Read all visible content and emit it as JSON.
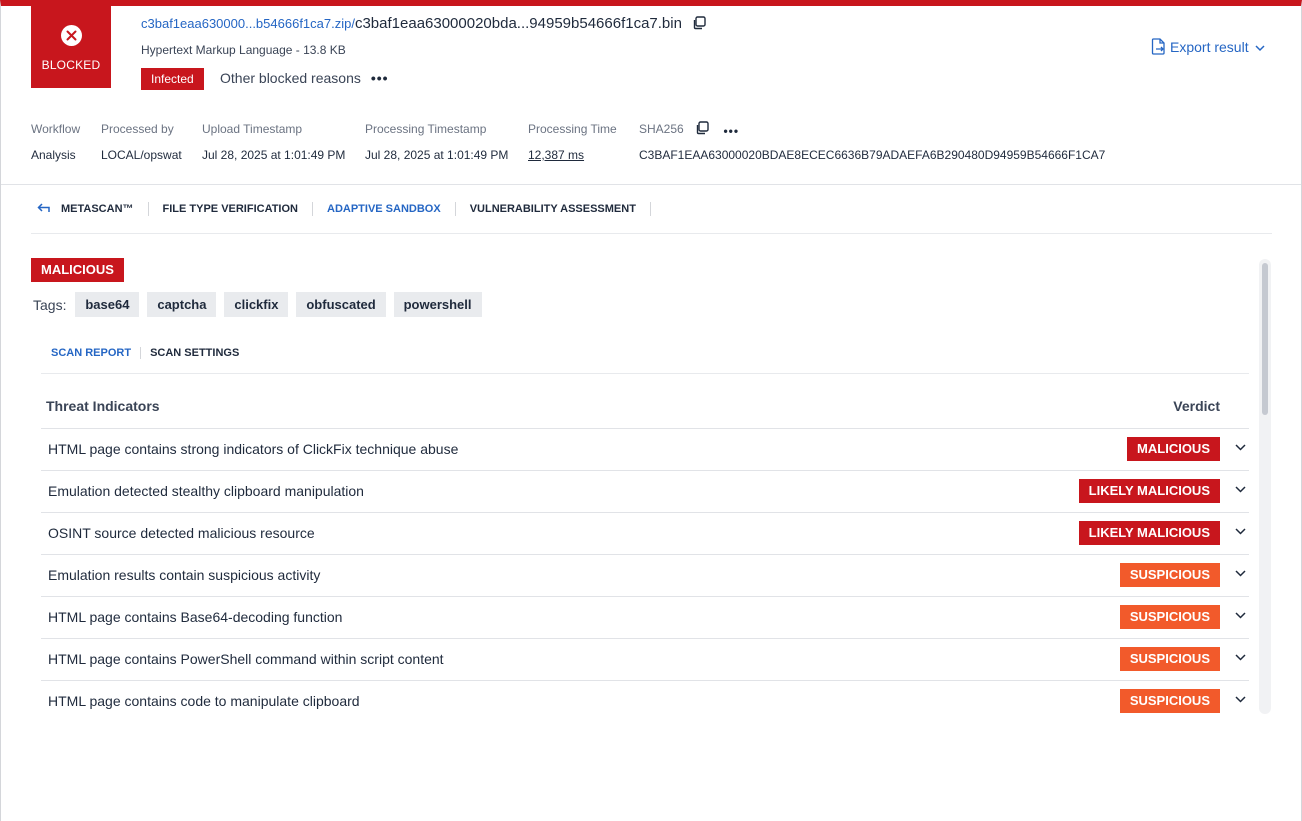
{
  "header": {
    "status_label": "BLOCKED",
    "zip_path": "c3baf1eaa630000...b54666f1ca7.zip/",
    "file_name": "c3baf1eaa63000020bda...94959b54666f1ca7.bin",
    "file_type": "Hypertext Markup Language - 13.8 KB",
    "infected_badge": "Infected",
    "other_reasons": "Other blocked reasons",
    "more": "•••",
    "export_label": "Export result"
  },
  "meta": {
    "workflow_label": "Workflow",
    "workflow_value": "Analysis",
    "processed_by_label": "Processed by",
    "processed_by_value": "LOCAL/opswat",
    "upload_label": "Upload Timestamp",
    "upload_value": "Jul 28, 2025 at 1:01:49 PM",
    "processing_ts_label": "Processing Timestamp",
    "processing_ts_value": "Jul 28, 2025 at 1:01:49 PM",
    "processing_time_label": "Processing Time",
    "processing_time_value": "12,387 ms",
    "sha_label": "SHA256",
    "sha_value": "C3BAF1EAA63000020BDAE8ECEC6636B79ADAEFA6B290480D94959B54666F1CA7",
    "sha_more": "•••"
  },
  "tabs": [
    {
      "label": "METASCAN™"
    },
    {
      "label": "FILE TYPE VERIFICATION"
    },
    {
      "label": "ADAPTIVE SANDBOX"
    },
    {
      "label": "VULNERABILITY ASSESSMENT"
    }
  ],
  "result": {
    "overall_verdict": "MALICIOUS",
    "tags_label": "Tags:",
    "tags": [
      "base64",
      "captcha",
      "clickfix",
      "obfuscated",
      "powershell"
    ],
    "sub_tabs": [
      "SCAN REPORT",
      "SCAN SETTINGS"
    ],
    "table": {
      "col_indicators": "Threat Indicators",
      "col_verdict": "Verdict",
      "rows": [
        {
          "desc": "HTML page contains strong indicators of ClickFix technique abuse",
          "verdict": "MALICIOUS"
        },
        {
          "desc": "Emulation detected stealthy clipboard manipulation",
          "verdict": "LIKELY MALICIOUS"
        },
        {
          "desc": "OSINT source detected malicious resource",
          "verdict": "LIKELY MALICIOUS"
        },
        {
          "desc": "Emulation results contain suspicious activity",
          "verdict": "SUSPICIOUS"
        },
        {
          "desc": "HTML page contains Base64-decoding function",
          "verdict": "SUSPICIOUS"
        },
        {
          "desc": "HTML page contains PowerShell command within script content",
          "verdict": "SUSPICIOUS"
        },
        {
          "desc": "HTML page contains code to manipulate clipboard",
          "verdict": "SUSPICIOUS"
        }
      ]
    }
  },
  "colors": {
    "accent_red": "#c8161d",
    "suspicious_orange": "#f25a2b",
    "link_blue": "#2566c4"
  }
}
